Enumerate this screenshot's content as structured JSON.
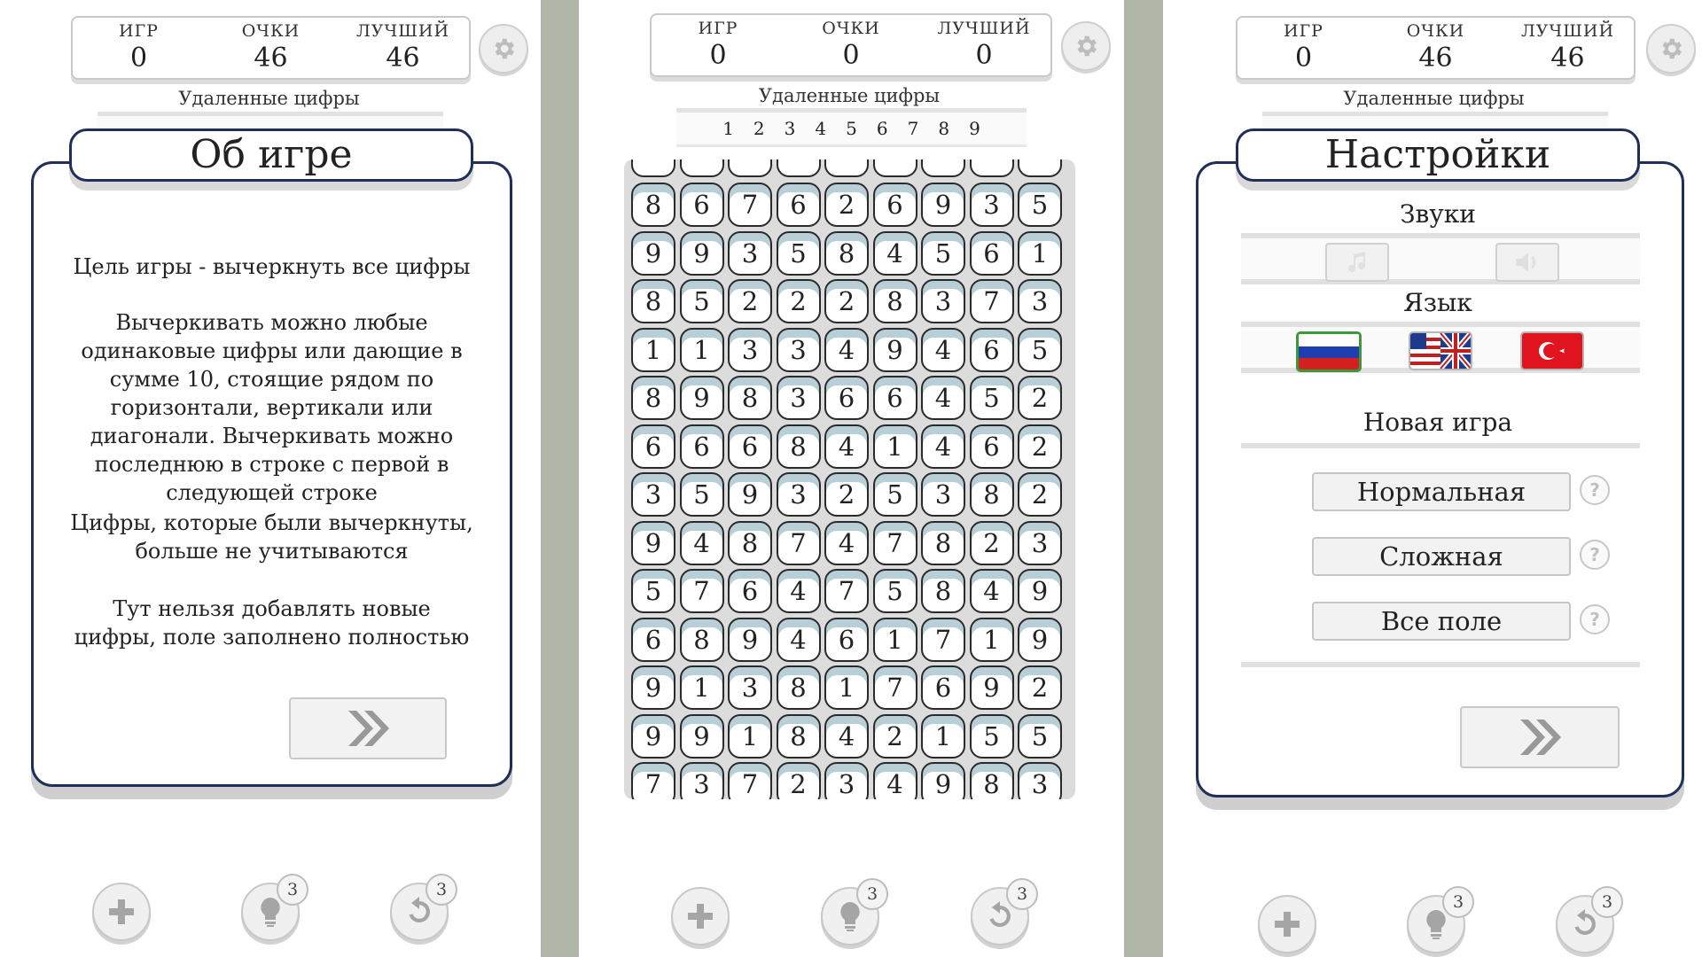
{
  "score_labels": {
    "games": "ИГР",
    "points": "ОЧКИ",
    "best": "ЛУЧШИЙ"
  },
  "removed_title": "Удаленные цифры",
  "removed_digits": [
    "1",
    "2",
    "3",
    "4",
    "5",
    "6",
    "7",
    "8",
    "9"
  ],
  "badge_count": "3",
  "panel1": {
    "scores": {
      "games": "0",
      "points": "46",
      "best": "46"
    },
    "dialog_title": "Об игре",
    "paragraphs": [
      "Цель игры - вычеркнуть все цифры",
      "Вычеркивать можно любые одинаковые цифры или дающие в сумме 10, стоящие рядом по горизонтали, вертикали или диагонали. Вычеркивать можно последнюю в строке с первой в следующей строке",
      "Цифры, которые были вычеркнуты, больше не учитываются",
      "Тут нельзя добавлять новые цифры, поле заполнено полностью"
    ]
  },
  "panel2": {
    "scores": {
      "games": "0",
      "points": "0",
      "best": "0"
    },
    "grid": [
      [
        "8",
        "6",
        "7",
        "6",
        "2",
        "6",
        "9",
        "3",
        "5"
      ],
      [
        "9",
        "9",
        "3",
        "5",
        "8",
        "4",
        "5",
        "6",
        "1"
      ],
      [
        "8",
        "5",
        "2",
        "2",
        "2",
        "8",
        "3",
        "7",
        "3"
      ],
      [
        "1",
        "1",
        "3",
        "3",
        "4",
        "9",
        "4",
        "6",
        "5"
      ],
      [
        "8",
        "9",
        "8",
        "3",
        "6",
        "6",
        "4",
        "5",
        "2"
      ],
      [
        "6",
        "6",
        "6",
        "8",
        "4",
        "1",
        "4",
        "6",
        "2"
      ],
      [
        "3",
        "5",
        "9",
        "3",
        "2",
        "5",
        "3",
        "8",
        "2"
      ],
      [
        "9",
        "4",
        "8",
        "7",
        "4",
        "7",
        "8",
        "2",
        "3"
      ],
      [
        "5",
        "7",
        "6",
        "4",
        "7",
        "5",
        "8",
        "4",
        "9"
      ],
      [
        "6",
        "8",
        "9",
        "4",
        "6",
        "1",
        "7",
        "1",
        "9"
      ],
      [
        "9",
        "1",
        "3",
        "8",
        "1",
        "7",
        "6",
        "9",
        "2"
      ],
      [
        "9",
        "9",
        "1",
        "8",
        "4",
        "2",
        "1",
        "5",
        "5"
      ],
      [
        "7",
        "3",
        "7",
        "2",
        "3",
        "4",
        "9",
        "8",
        "3"
      ]
    ]
  },
  "panel3": {
    "scores": {
      "games": "0",
      "points": "46",
      "best": "46"
    },
    "dialog_title": "Настройки",
    "sounds_title": "Звуки",
    "language_title": "Язык",
    "new_game_title": "Новая игра",
    "modes": [
      "Нормальная",
      "Сложная",
      "Все поле"
    ],
    "help_glyph": "?"
  },
  "colors": {
    "dialog_border": "#1f2f5a",
    "cell_highlight": "#b9cfd8",
    "divider": "#b0b7a8"
  }
}
